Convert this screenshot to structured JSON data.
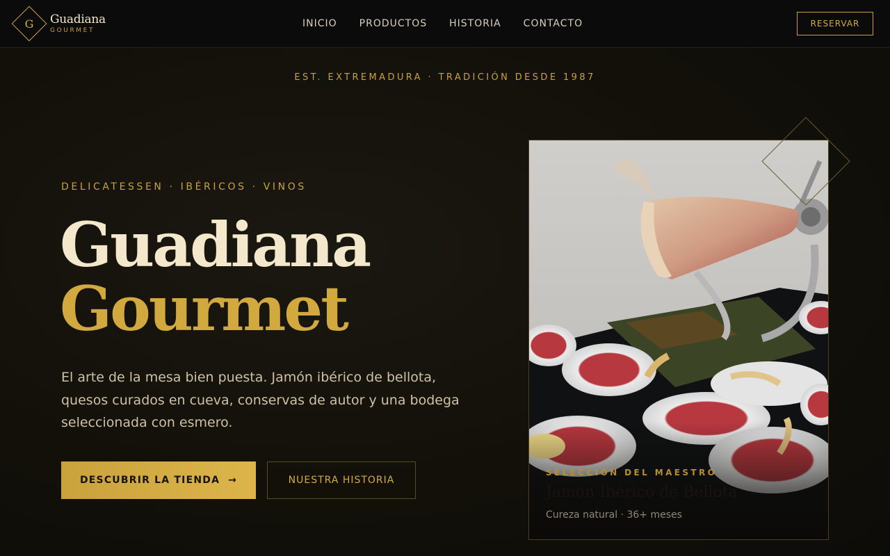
{
  "brand": {
    "letter": "G",
    "name": "Guadiana",
    "sub": "GOURMET"
  },
  "nav": {
    "items": [
      "INICIO",
      "PRODUCTOS",
      "HISTORIA",
      "CONTACTO"
    ],
    "cta": "RESERVAR"
  },
  "est_line": "EST. EXTREMADURA · TRADICIÓN DESDE 1987",
  "hero": {
    "eyebrow": "DELICATESSEN · IBÉRICOS · VINOS",
    "title_line1": "Guadiana",
    "title_line2": "Gourmet",
    "description": "El arte de la mesa bien puesta. Jamón ibérico de bellota, quesos curados en cueva, conservas de autor y una bodega seleccionada con esmero.",
    "primary_button": "DESCUBRIR LA TIENDA",
    "primary_arrow": "→",
    "secondary_button": "NUESTRA HISTORIA"
  },
  "feature_card": {
    "kicker": "SELECCIÓN DEL MAESTRO",
    "title": "Jamón Ibérico de Bellota",
    "subtitle": "Cureza natural · 36+ meses"
  },
  "colors": {
    "gold": "#c9a23f",
    "background": "#121009",
    "cream": "#f4e8cc"
  },
  "icons": [
    "diamond-logo-icon",
    "arrow-right-icon",
    "diamond-ornament-icon"
  ]
}
